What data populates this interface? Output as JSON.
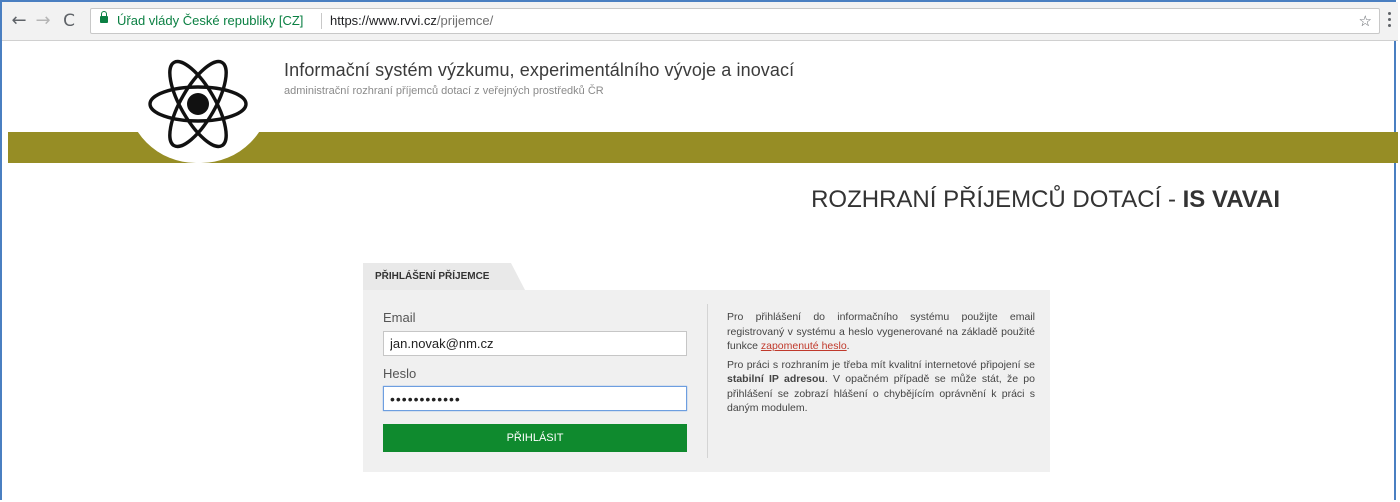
{
  "browser": {
    "site_name": "Úřad vlády České republiky [CZ]",
    "url_host": "https://www.rvvi.cz",
    "url_path": "/prijemce/",
    "back_glyph": "←",
    "forward_glyph": "→",
    "reload_glyph": "C",
    "star_glyph": "☆",
    "icons": [
      "back-arrow-icon",
      "forward-arrow-icon",
      "reload-icon",
      "lock-icon",
      "star-icon",
      "menu-dots-icon"
    ]
  },
  "header": {
    "title": "Informační systém výzkumu, experimentálního vývoje a inovací",
    "subtitle": "administrační rozhraní příjemců dotací z veřejných prostředků ČR",
    "logo_icon": "atom-logo-icon",
    "bar_color": "#968d25"
  },
  "page_heading": {
    "text": "ROZHRANÍ PŘÍJEMCŮ DOTACÍ - ",
    "bold": "IS VAVAI"
  },
  "login": {
    "tab_label": "PŘIHLÁŠENÍ PŘÍJEMCE",
    "email_label": "Email",
    "email_value": "jan.novak@nm.cz",
    "password_label": "Heslo",
    "password_value": "••••••••••••",
    "submit_label": "PŘIHLÁSIT",
    "submit_color": "#0f8a2e"
  },
  "info": {
    "p1_text": "Pro přihlášení do informačního systému použijte email registrovaný v systému a heslo vygenerované na základě použité funkce ",
    "p1_link": "zapomenuté heslo",
    "p1_end": ".",
    "p2_start": "Pro práci s rozhraním je třeba mít kvalitní internetové připojení se ",
    "p2_bold": "stabilní IP adresou",
    "p2_end": ". V opačném případě se může stát, že po přihlášení se zobrazí hlášení o chybějícím oprávnění k práci s daným modulem."
  }
}
